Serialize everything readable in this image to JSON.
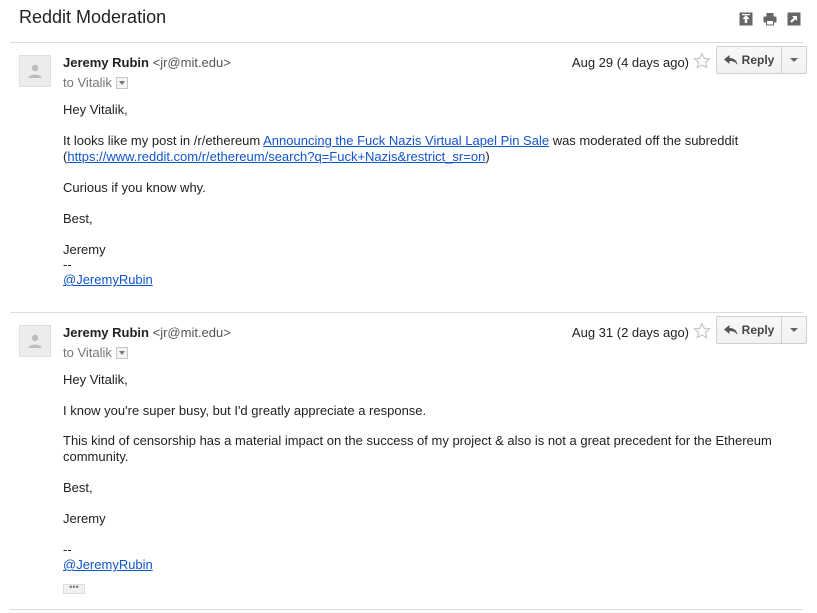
{
  "thread": {
    "subject": "Reddit Moderation"
  },
  "messages": [
    {
      "sender_name": "Jeremy Rubin",
      "sender_email": "<jr@mit.edu>",
      "to_line": "to Vitalik",
      "date": "Aug 29 (4 days ago)",
      "reply_label": "Reply",
      "greeting": "Hey Vitalik,",
      "para1_pre": "It looks like my post in /r/ethereum ",
      "para1_link": "Announcing the Fuck Nazis Virtual Lapel Pin Sale",
      "para1_post": " was moderated off the subreddit",
      "para1_open": "(",
      "para1_url": "https://www.reddit.com/r/ethereum/search?q=Fuck+Nazis&restrict_sr=on",
      "para1_close": ")",
      "para2": "Curious if you know why.",
      "signoff": "Best,",
      "name": "Jeremy",
      "sig_dash": "--",
      "sig_handle": "@JeremyRubin"
    },
    {
      "sender_name": "Jeremy Rubin",
      "sender_email": "<jr@mit.edu>",
      "to_line": "to Vitalik",
      "date": "Aug 31 (2 days ago)",
      "reply_label": "Reply",
      "greeting": "Hey Vitalik,",
      "para1": "I know you're super busy, but I'd greatly appreciate a response.",
      "para2_line1": "This kind of censorship has a material impact on the success of my project & also is not a great precedent for the Ethereum",
      "para2_line2": "community.",
      "signoff": "Best,",
      "name": "Jeremy",
      "sig_dash": "--",
      "sig_handle": "@JeremyRubin",
      "trimmed_content": "•••"
    }
  ],
  "icons": {
    "top": [
      "expand-all-icon",
      "print-icon",
      "new-window-icon"
    ],
    "star": "star-icon",
    "reply": "reply-arrow-icon"
  },
  "colors": {
    "link": "#1155cc",
    "divider": "#dcdcdc",
    "star": "#c6c6c6"
  }
}
